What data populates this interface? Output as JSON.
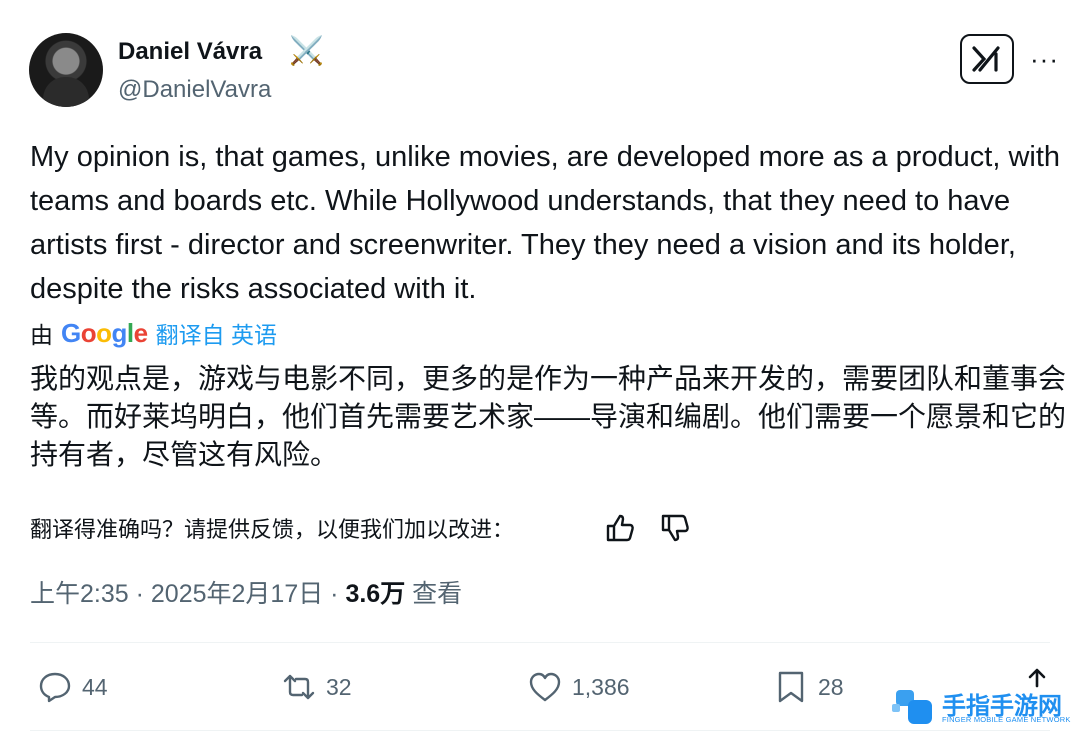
{
  "author": {
    "name": "Daniel Vávra",
    "badge": "⚔️",
    "handle": "@DanielVavra"
  },
  "header_actions": {
    "grok_icon": "grok-icon",
    "more_label": "···"
  },
  "tweet": {
    "text": "My opinion is, that games, unlike movies, are developed more as a product, with teams and boards etc. While Hollywood understands, that they need to have artists first - director and screenwriter. They they need a vision and its holder, despite the risks associated with it."
  },
  "translation": {
    "by_prefix": "由",
    "provider": "Google",
    "link_label": "翻译自 英语",
    "text": "我的观点是，游戏与电影不同，更多的是作为一种产品来开发的，需要团队和董事会等。而好莱坞明白，他们首先需要艺术家——导演和编剧。他们需要一个愿景和它的持有者，尽管这有风险。",
    "feedback_prompt": "翻译得准确吗？请提供反馈，以便我们加以改进："
  },
  "meta": {
    "time": "上午2:35",
    "sep1": " · ",
    "date": "2025年2月17日",
    "sep2": " · ",
    "views": "3.6万",
    "views_label": " 查看"
  },
  "actions": {
    "replies": "44",
    "reposts": "32",
    "likes": "1,386",
    "bookmarks": "28"
  },
  "watermark": {
    "title": "手指手游网",
    "subtitle": "FINGER MOBILE GAME NETWORK"
  },
  "colors": {
    "text": "#0f1419",
    "secondary": "#536471",
    "link": "#1d9bf0",
    "divider": "#eff3f4"
  }
}
